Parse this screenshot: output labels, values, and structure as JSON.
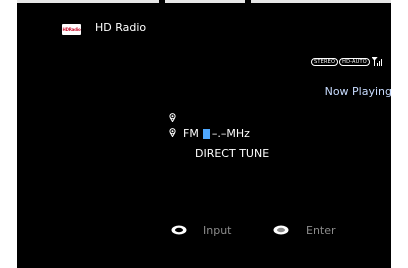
{
  "source": {
    "logo_text": "HDRadio",
    "title": "HD Radio"
  },
  "status": {
    "badges": [
      "STEREO",
      "HD-AUTO"
    ],
    "signal_icon": "signal-strength-icon"
  },
  "now_playing": "Now Playing",
  "tuner": {
    "band": "FM",
    "frequency_placeholder": "–.–MHz",
    "mode": "DIRECT TUNE"
  },
  "hints": {
    "input_label": "Input",
    "enter_label": "Enter"
  },
  "colors": {
    "background": "#000000",
    "now_playing": "#c8dcff",
    "cursor": "#4fa8ff",
    "hint_text": "#8c8c8c"
  }
}
